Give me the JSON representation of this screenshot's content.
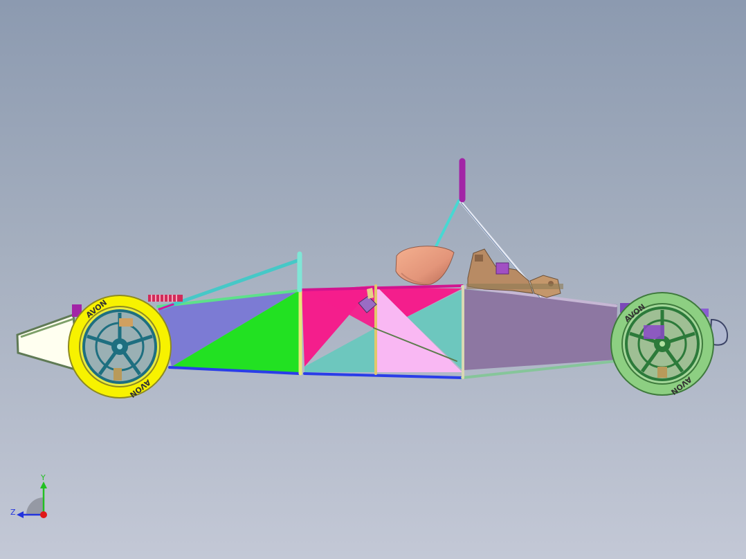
{
  "tires": {
    "front_brand": "AVON",
    "rear_brand": "AVON"
  },
  "triad": {
    "y_label": "Y",
    "z_label": "Z"
  },
  "colors": {
    "background_top": "#8c9ab0",
    "background_bottom": "#c3c8d6",
    "nose": "#fffff0",
    "front_tire": "#f7f200",
    "front_rim": "#1e6f80",
    "rear_tire": "#8dcf82",
    "rear_rim": "#2c7a3a",
    "panel_blue": "#7c7bd4",
    "panel_green": "#22e122",
    "panel_magenta": "#f41e8c",
    "panel_teal": "#6dc7be",
    "panel_pink": "#f9b8f3",
    "panel_mauve": "#8d77a2",
    "seat": "#e3957a",
    "engine": "#b88b64",
    "roll_hoop": "#a224a6"
  }
}
